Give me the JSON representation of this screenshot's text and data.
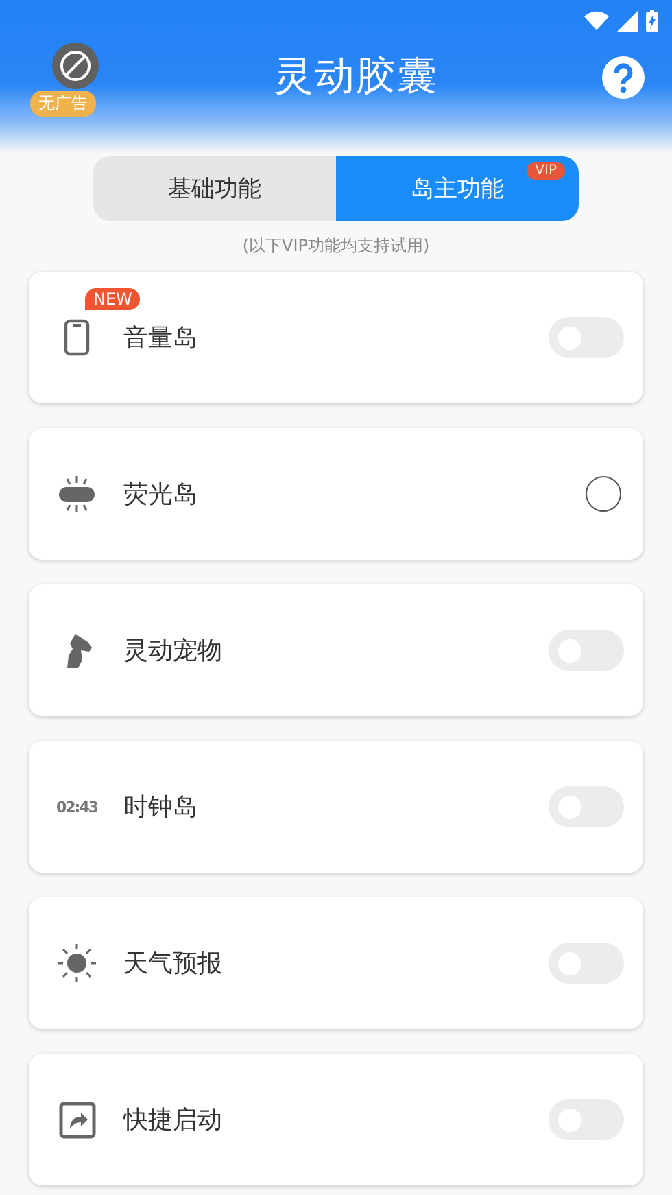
{
  "header": {
    "title": "灵动胶囊",
    "ad_badge": "无广告"
  },
  "tabs": [
    {
      "label": "基础功能",
      "selected": false
    },
    {
      "label": "岛主功能",
      "selected": true,
      "badge": "VIP"
    }
  ],
  "hint": "(以下VIP功能均支持试用)",
  "features": [
    {
      "kind": "switch",
      "label": "音量岛",
      "badge": "NEW",
      "on": false
    },
    {
      "kind": "radio",
      "label": "荧光岛",
      "selected": false
    },
    {
      "kind": "switch",
      "label": "灵动宠物",
      "on": false
    },
    {
      "kind": "switch",
      "icon_text": "02:43",
      "label": "时钟岛",
      "on": false
    },
    {
      "kind": "switch",
      "label": "天气预报",
      "on": false
    },
    {
      "kind": "switch",
      "label": "快捷启动",
      "on": false
    }
  ]
}
